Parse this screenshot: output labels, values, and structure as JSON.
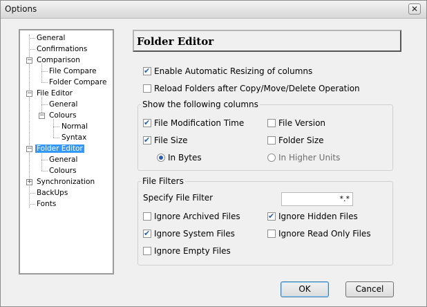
{
  "window": {
    "title": "Options",
    "close_label": "✕"
  },
  "tree": {
    "items": [
      {
        "label": "General"
      },
      {
        "label": "Confirmations"
      },
      {
        "label": "Comparison"
      },
      {
        "label": "File Compare"
      },
      {
        "label": "Folder Compare"
      },
      {
        "label": "File Editor"
      },
      {
        "label": "General"
      },
      {
        "label": "Colours"
      },
      {
        "label": "Normal"
      },
      {
        "label": "Syntax"
      },
      {
        "label": "Folder Editor"
      },
      {
        "label": "General"
      },
      {
        "label": "Colours"
      },
      {
        "label": "Synchronization"
      },
      {
        "label": "BackUps"
      },
      {
        "label": "Fonts"
      }
    ],
    "selected": "Folder Editor"
  },
  "panel": {
    "title": "Folder Editor",
    "auto_resize_label": "Enable Automatic Resizing of columns",
    "reload_label": "Reload Folders after Copy/Move/Delete Operation",
    "columns_group_label": "Show the following columns",
    "col_mod_time": "File Modification Time",
    "col_version": "File Version",
    "col_size": "File Size",
    "col_folder_size": "Folder Size",
    "in_bytes": "In Bytes",
    "in_higher_units": "In Higher Units",
    "filters_group_label": "File Filters",
    "specify_filter_label": "Specify File Filter",
    "filter_value": "*.*",
    "ignore_archived": "Ignore Archived Files",
    "ignore_hidden": "Ignore Hidden Files",
    "ignore_system": "Ignore System Files",
    "ignore_readonly": "Ignore Read Only Files",
    "ignore_empty": "Ignore Empty Files"
  },
  "buttons": {
    "ok": "OK",
    "cancel": "Cancel"
  },
  "states": {
    "auto_resize": true,
    "reload": false,
    "col_mod_time": true,
    "col_version": false,
    "col_size": true,
    "col_folder_size": false,
    "size_unit": "In Bytes",
    "ignore_archived": false,
    "ignore_hidden": true,
    "ignore_system": true,
    "ignore_readonly": false,
    "ignore_empty": false
  }
}
